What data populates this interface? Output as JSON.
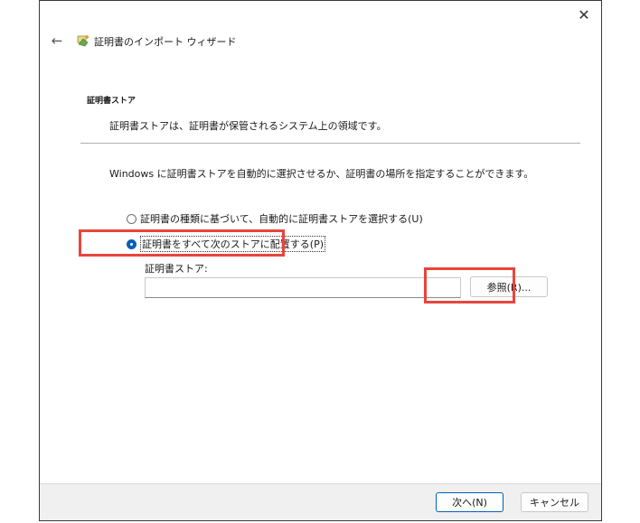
{
  "window": {
    "title": "証明書のインポート ウィザード",
    "close_label": "✕",
    "back_label": "←",
    "title_icon": "certificate-icon"
  },
  "section": {
    "heading": "証明書ストア",
    "description": "証明書ストアは、証明書が保管されるシステム上の領域です。"
  },
  "main": {
    "intro": "Windows に証明書ストアを自動的に選択させるか、証明書の場所を指定することができます。",
    "options": [
      {
        "label": "証明書の種類に基づいて、自動的に証明書ストアを選択する(U)",
        "checked": false
      },
      {
        "label": "証明書をすべて次のストアに配置する(P)",
        "checked": true
      }
    ],
    "store_label": "証明書ストア:",
    "store_value": "",
    "browse_label": "参照(R)..."
  },
  "footer": {
    "next_label": "次へ(N)",
    "cancel_label": "キャンセル"
  },
  "colors": {
    "highlight": "#e8453c",
    "accent": "#005fb8"
  }
}
